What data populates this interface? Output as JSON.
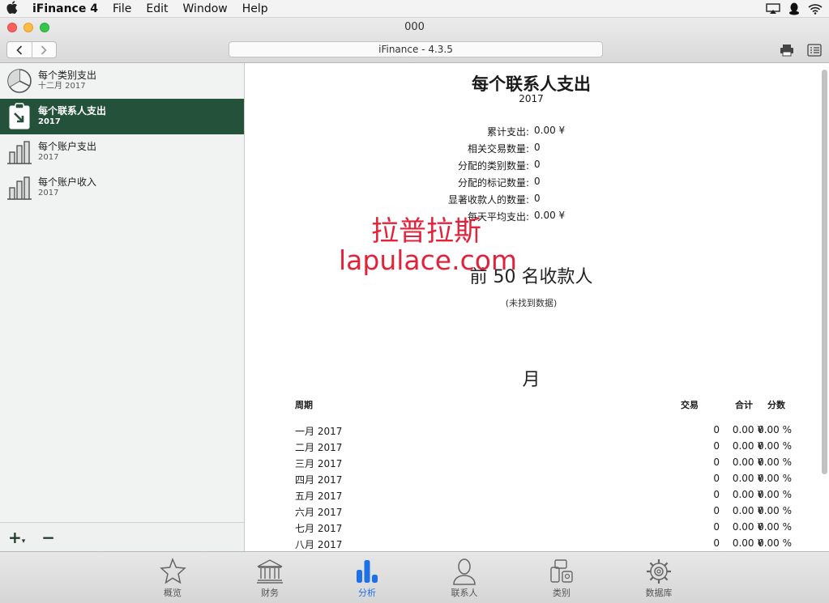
{
  "menubar": {
    "app_name": "iFinance 4",
    "items": [
      "File",
      "Edit",
      "Window",
      "Help"
    ]
  },
  "window": {
    "title": "000",
    "address": "iFinance - 4.3.5",
    "nav_back": "<",
    "nav_forward": ">"
  },
  "sidebar": {
    "items": [
      {
        "title": "每个类别支出",
        "subtitle": "十二月 2017",
        "icon": "pie-chart-icon"
      },
      {
        "title": "每个联系人支出",
        "subtitle": "2017",
        "icon": "clipboard-arrow-icon"
      },
      {
        "title": "每个账户支出",
        "subtitle": "2017",
        "icon": "bar-chart-icon"
      },
      {
        "title": "每个账户收入",
        "subtitle": "2017",
        "icon": "bar-chart-icon"
      }
    ],
    "selected_index": 1,
    "add_label": "+",
    "remove_label": "−"
  },
  "report": {
    "title": "每个联系人支出",
    "year": "2017",
    "stats": [
      {
        "label": "累计支出:",
        "value": "0.00 ¥"
      },
      {
        "label": "相关交易数量:",
        "value": "0"
      },
      {
        "label": "分配的类别数量:",
        "value": "0"
      },
      {
        "label": "分配的标记数量:",
        "value": "0"
      },
      {
        "label": "显著收款人的数量:",
        "value": "0"
      },
      {
        "label": "每天平均支出:",
        "value": "0.00 ¥"
      }
    ],
    "top_payees_heading": "前 50 名收款人",
    "no_data": "(未找到数据)",
    "month_heading": "月",
    "table_headers": {
      "period": "周期",
      "transactions": "交易",
      "total": "合计",
      "share": "分数"
    },
    "rows": [
      {
        "period": "一月 2017",
        "transactions": "0",
        "total": "0.00 ¥",
        "share": "0.00 %"
      },
      {
        "period": "二月 2017",
        "transactions": "0",
        "total": "0.00 ¥",
        "share": "0.00 %"
      },
      {
        "period": "三月 2017",
        "transactions": "0",
        "total": "0.00 ¥",
        "share": "0.00 %"
      },
      {
        "period": "四月 2017",
        "transactions": "0",
        "total": "0.00 ¥",
        "share": "0.00 %"
      },
      {
        "period": "五月 2017",
        "transactions": "0",
        "total": "0.00 ¥",
        "share": "0.00 %"
      },
      {
        "period": "六月 2017",
        "transactions": "0",
        "total": "0.00 ¥",
        "share": "0.00 %"
      },
      {
        "period": "七月 2017",
        "transactions": "0",
        "total": "0.00 ¥",
        "share": "0.00 %"
      },
      {
        "period": "八月 2017",
        "transactions": "0",
        "total": "0.00 ¥",
        "share": "0.00 %"
      }
    ]
  },
  "watermark": {
    "cn": "拉普拉斯",
    "en": "lapulace.com"
  },
  "tabs": [
    {
      "label": "概览",
      "icon": "star-icon"
    },
    {
      "label": "财务",
      "icon": "bank-icon"
    },
    {
      "label": "分析",
      "icon": "bar-chart-icon"
    },
    {
      "label": "联系人",
      "icon": "person-icon"
    },
    {
      "label": "类别",
      "icon": "category-icon"
    },
    {
      "label": "数据库",
      "icon": "gear-icon"
    }
  ],
  "active_tab": "分析",
  "colors": {
    "accent": "#1f70e6",
    "selection": "#24513a",
    "watermark": "#e0233a"
  }
}
